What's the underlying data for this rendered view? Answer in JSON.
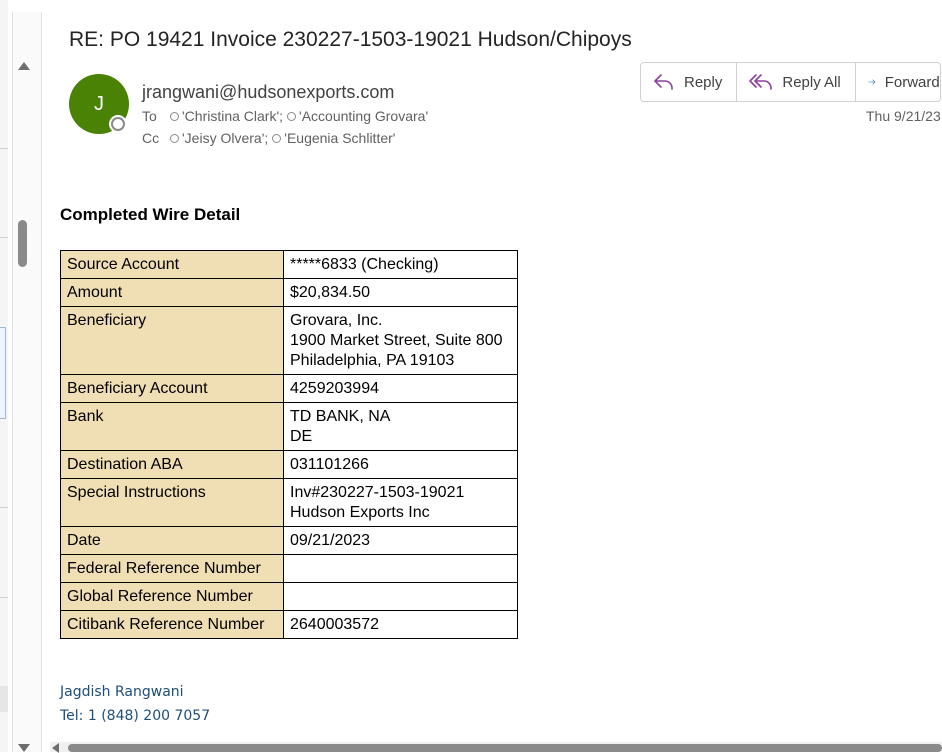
{
  "email": {
    "subject": "RE: PO 19421 Invoice 230227-1503-19021 Hudson/Chipoys",
    "avatar_initial": "J",
    "avatar_color": "#498205",
    "sender": "jrangwani@hudsonexports.com",
    "to_label": "To",
    "to": [
      "'Christina Clark';",
      "'Accounting Grovara'"
    ],
    "cc_label": "Cc",
    "cc": [
      "'Jeisy Olvera';",
      "'Eugenia Schlitter'"
    ],
    "date": "Thu 9/21/23"
  },
  "actions": {
    "reply": "Reply",
    "reply_all": "Reply All",
    "forward": "Forward"
  },
  "body": {
    "heading": "Completed Wire Detail",
    "table": [
      {
        "key": "Source Account",
        "value": [
          "*****6833 (Checking)"
        ]
      },
      {
        "key": "Amount",
        "value": [
          "$20,834.50"
        ]
      },
      {
        "key": "Beneficiary",
        "value": [
          "Grovara, Inc.",
          "1900 Market Street, Suite 800",
          "Philadelphia, PA 19103"
        ]
      },
      {
        "key": "Beneficiary Account",
        "value": [
          "4259203994"
        ]
      },
      {
        "key": "Bank",
        "value": [
          "TD BANK, NA",
          "DE"
        ]
      },
      {
        "key": "Destination ABA",
        "value": [
          "031101266"
        ]
      },
      {
        "key": "Special Instructions",
        "value": [
          "Inv#230227-1503-19021",
          "Hudson Exports Inc"
        ]
      },
      {
        "key": "Date",
        "value": [
          "09/21/2023"
        ]
      },
      {
        "key": "Federal Reference Number",
        "value": []
      },
      {
        "key": "Global Reference Number",
        "value": []
      },
      {
        "key": "Citibank Reference Number",
        "value": [
          "2640003572"
        ]
      }
    ],
    "signature_name": "Jagdish Rangwani",
    "signature_tel": "Tel: 1 (848) 200 7057"
  },
  "colors": {
    "table_key_bg": "#f0deb4",
    "accent_icon": "#8e3fa0",
    "forward_icon": "#0f6cbd",
    "signature": "#1f4e79"
  }
}
